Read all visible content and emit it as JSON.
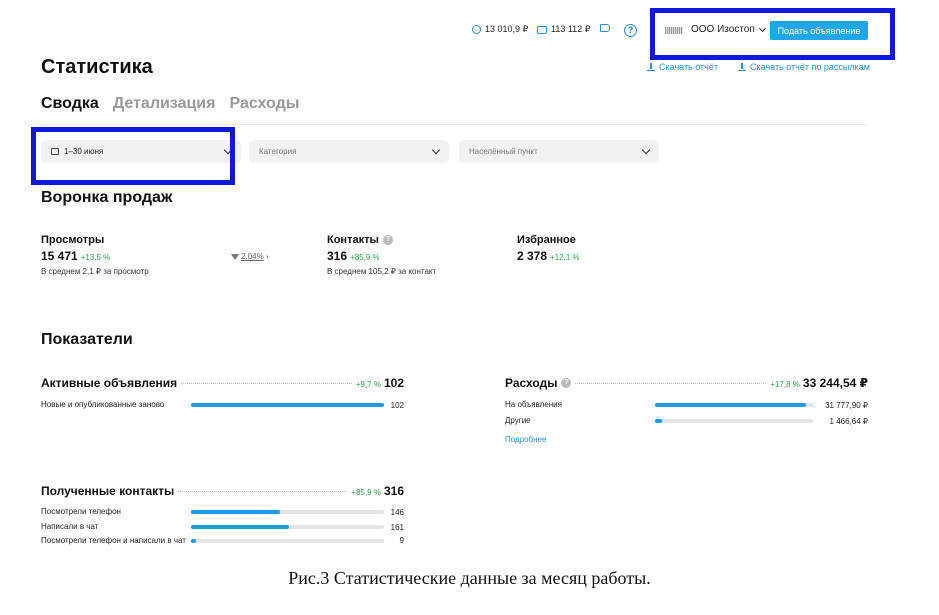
{
  "header": {
    "balance_1": "13 010,9 ₽",
    "balance_2": "113 112 ₽",
    "company": "ООО Изостоп",
    "post_button": "Подать объявление"
  },
  "page": {
    "title": "Статистика",
    "download_report": "Скачать отчёт",
    "download_mailing_report": "Скачать отчёт по рассылкам"
  },
  "tabs": [
    "Сводка",
    "Детализация",
    "Расходы"
  ],
  "filters": {
    "period": "1–30 июня",
    "category": "Категория",
    "city": "Населённый пункт"
  },
  "funnel": {
    "title": "Воронка продаж",
    "views": {
      "label": "Просмотры",
      "value": "15 471",
      "pct": "+13,5 %",
      "sub": "В среднем 2,1 ₽ за просмотр"
    },
    "conversion": "2,04%",
    "contacts": {
      "label": "Контакты",
      "value": "316",
      "pct": "+85,9 %",
      "sub": "В среднем 105,2 ₽ за контакт"
    },
    "favorites": {
      "label": "Избранное",
      "value": "2 378",
      "pct": "+12,1 %"
    }
  },
  "indicators": {
    "title": "Показатели",
    "active_ads": {
      "label": "Активные объявления",
      "pct": "+9,7 %",
      "total": "102",
      "rows": [
        {
          "label": "Новые и опубликованные заново",
          "value": "102",
          "share": 1.0
        }
      ]
    },
    "expenses": {
      "label": "Расходы",
      "pct": "+17,8 %",
      "total": "33 244,54 ₽",
      "rows": [
        {
          "label": "На объявления",
          "value": "31 777,90 ₽",
          "share": 0.956
        },
        {
          "label": "Другие",
          "value": "1 466,64 ₽",
          "share": 0.044
        }
      ],
      "more": "Подробнее"
    },
    "contacts_received": {
      "label": "Полученные контакты",
      "pct": "+85,9 %",
      "total": "316",
      "rows": [
        {
          "label": "Посмотрели телефон",
          "value": "146",
          "share": 0.462
        },
        {
          "label": "Написали в чат",
          "value": "161",
          "share": 0.509
        },
        {
          "label": "Посмотрели телефон и написали в чат",
          "value": "9",
          "share": 0.028
        }
      ]
    }
  },
  "caption": "Рис.3 Статистические данные за месяц работы.",
  "colors": {
    "accent": "#1ea7ec",
    "highlight": "#1019d9",
    "positive": "#2ca44a",
    "bar": "#1f9be5"
  }
}
